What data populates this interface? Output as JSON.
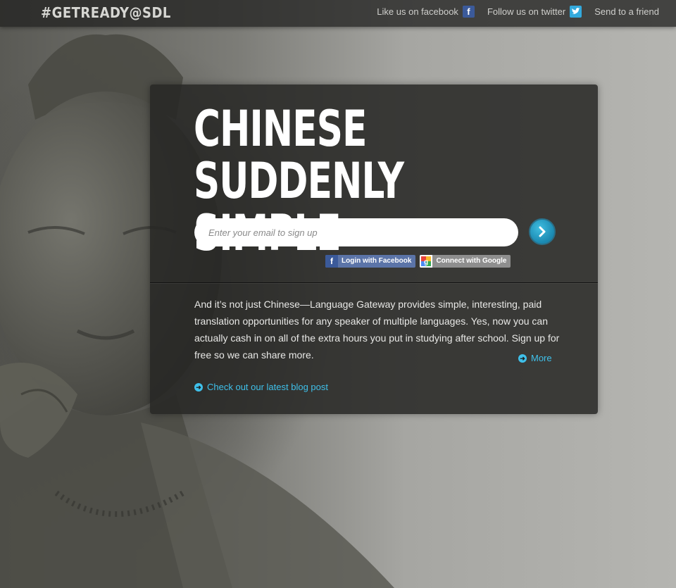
{
  "brand": {
    "logo": "#GETREADY@SDL"
  },
  "nav": {
    "facebook": {
      "label": "Like us on facebook",
      "icon": "facebook-icon"
    },
    "twitter": {
      "label": "Follow us on twitter",
      "icon": "twitter-icon"
    },
    "send": {
      "label": "Send to a friend"
    }
  },
  "hero": {
    "headline_line1": "CHINESE",
    "headline_line2": "SUDDENLY SIMPLE"
  },
  "signup": {
    "email_placeholder": "Enter your email to sign up",
    "submit_icon": "arrow-right-icon",
    "facebook_login": "Login with Facebook",
    "google_connect": "Connect with Google"
  },
  "content": {
    "body": "And it’s not just Chinese—Language Gateway provides simple, interesting, paid translation opportunities for any speaker of multiple languages. Yes, now you can actually cash in on all of the extra hours you put in studying after school. Sign up for free so we can share more.",
    "more_label": "More",
    "blog_label": "Check out our latest blog post"
  },
  "colors": {
    "accent": "#3fc0ea",
    "facebook": "#3b5a9a",
    "twitter": "#33a9dc",
    "panel": "#262624"
  }
}
